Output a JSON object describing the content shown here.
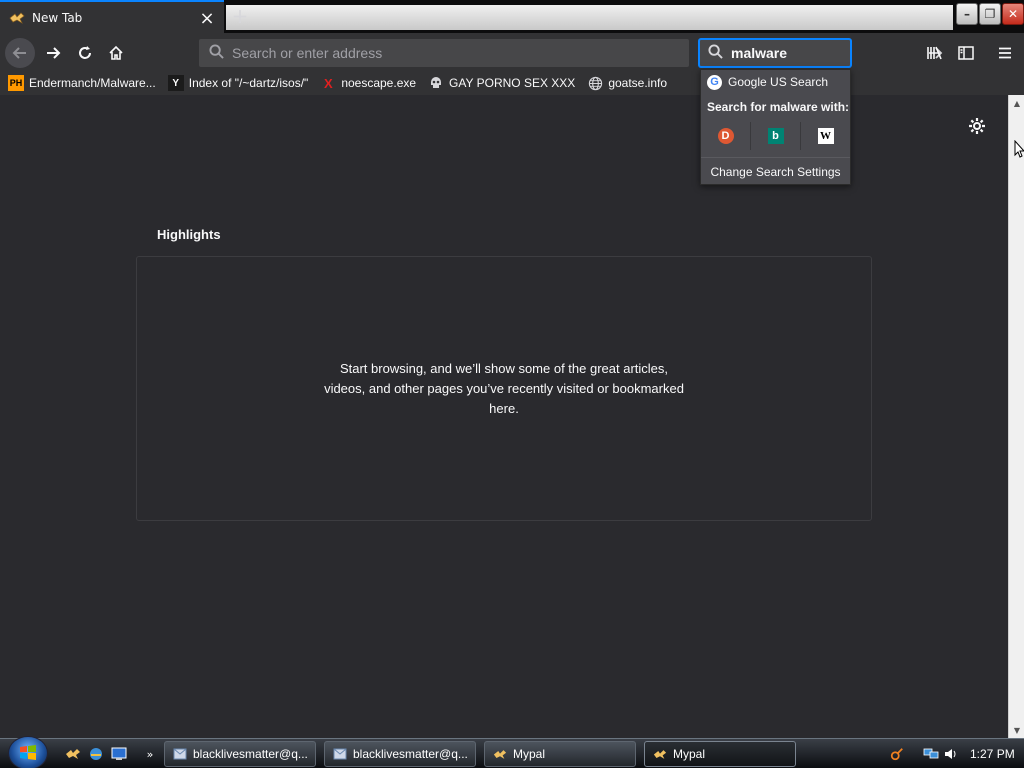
{
  "browser": {
    "tab_title": "New Tab",
    "new_tab_symbol": "+",
    "url_placeholder": "Search or enter address",
    "search_value": "malware"
  },
  "bookmarks": [
    {
      "label": "Endermanch/Malware...",
      "icon": "PH"
    },
    {
      "label": "Index of \"/~dartz/isos/\"",
      "icon": "Y"
    },
    {
      "label": "noescape.exe",
      "icon": "X"
    },
    {
      "label": "GAY PORNO SEX XXX",
      "icon": "skull"
    },
    {
      "label": "goatse.info",
      "icon": "globe"
    }
  ],
  "search_popup": {
    "engine": "Google US Search",
    "search_with": "Search for malware with:",
    "engines": [
      "duckduckgo-icon",
      "bing-icon",
      "wikipedia-icon"
    ],
    "settings": "Change Search Settings"
  },
  "content": {
    "highlights_title": "Highlights",
    "highlights_message": "Start browsing, and we’ll show some of the great articles, videos, and other pages you’ve recently visited or bookmarked here."
  },
  "taskbar": {
    "items": [
      {
        "label": "blacklivesmatter@q..."
      },
      {
        "label": "blacklivesmatter@q..."
      },
      {
        "label": "Mypal"
      },
      {
        "label": "Mypal"
      }
    ],
    "chevron": "»",
    "clock": "1:27 PM"
  },
  "colors": {
    "accent": "#0a84ff",
    "content_bg": "#2a2a2e",
    "toolbar_bg": "#323234"
  }
}
